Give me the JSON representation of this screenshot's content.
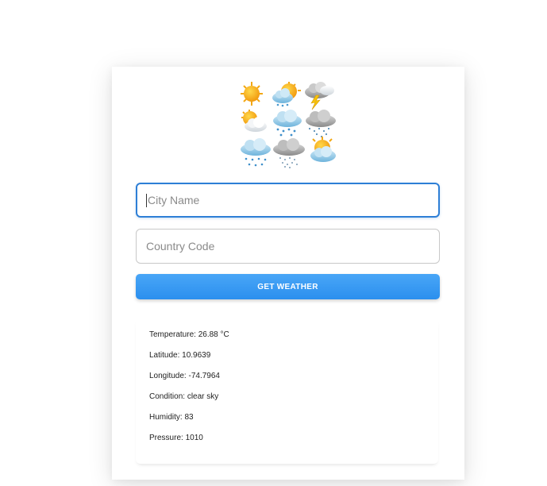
{
  "form": {
    "city_placeholder": "City Name",
    "country_placeholder": "Country Code",
    "button_label": "GET WEATHER"
  },
  "results": [
    {
      "label": "Temperature:",
      "value": "26.88 °C"
    },
    {
      "label": "Latitude:",
      "value": "10.9639"
    },
    {
      "label": "Longitude:",
      "value": "-74.7964"
    },
    {
      "label": "Condition:",
      "value": "clear sky"
    },
    {
      "label": "Humidity:",
      "value": "83"
    },
    {
      "label": "Pressure:",
      "value": "1010"
    }
  ],
  "logo": {
    "icons": [
      "sun-icon",
      "sun-rain-cloud-icon",
      "thunderstorm-cloud-icon",
      "sun-cloud-icon",
      "rain-cloud-icon",
      "gray-rain-cloud-icon",
      "showers-cloud-icon",
      "sleet-cloud-icon",
      "sun-behind-cloud-icon"
    ]
  },
  "colors": {
    "accent": "#2e7fd6",
    "button": "#3a9af3"
  }
}
